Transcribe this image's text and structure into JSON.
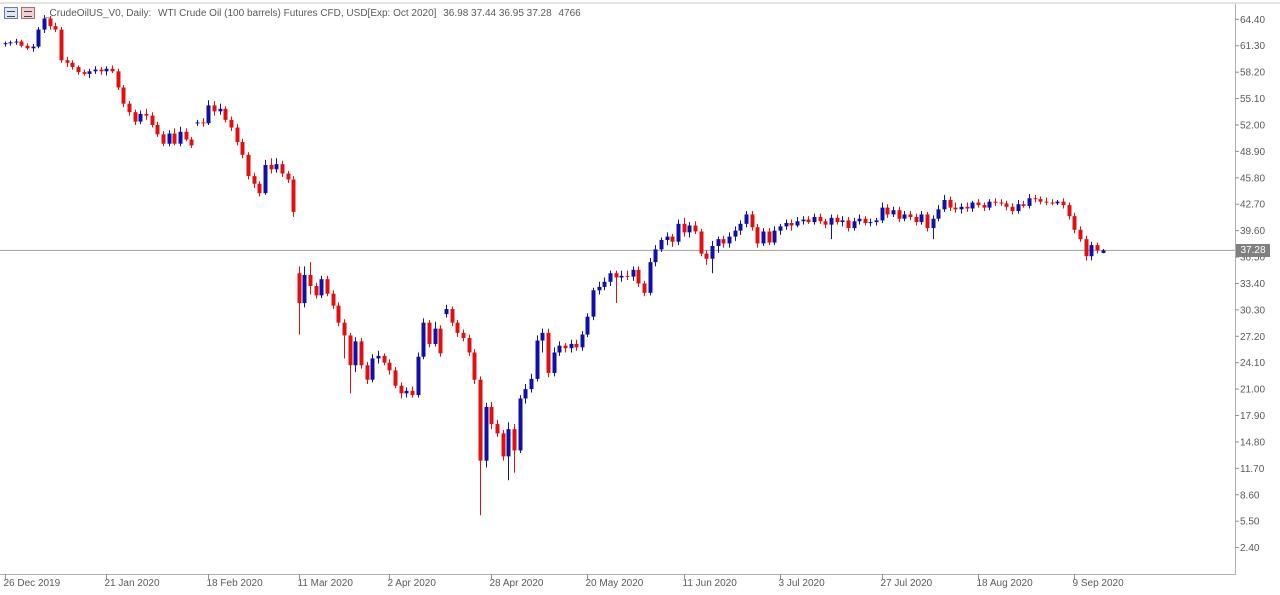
{
  "header": {
    "symbol": "_CrudeOilUS_V0, Daily:",
    "description": "WTI Crude Oil (100 barrels) Futures CFD, USD[Exp: Oct 2020]",
    "ohlc": "36.98 37.44 36.95 37.28",
    "volume": "4766"
  },
  "current_price_label": "37.28",
  "colors": {
    "bull": "#1010a8",
    "bear": "#e01010",
    "price_line": "#a0a0a0",
    "grid": "#c0c0c0",
    "text": "#5a5a5a"
  },
  "chart_data": {
    "type": "candlestick",
    "y_ticks": [
      "64.40",
      "61.30",
      "58.20",
      "55.10",
      "52.00",
      "48.90",
      "45.80",
      "42.70",
      "39.60",
      "36.50",
      "33.40",
      "30.30",
      "27.20",
      "24.10",
      "21.00",
      "17.90",
      "14.80",
      "11.70",
      "8.60",
      "5.50",
      "2.40"
    ],
    "x_ticks": [
      "26 Dec 2019",
      "21 Jan 2020",
      "18 Feb 2020",
      "11 Mar 2020",
      "2 Apr 2020",
      "28 Apr 2020",
      "20 May 2020",
      "11 Jun 2020",
      "3 Jul 2020",
      "27 Jul 2020",
      "18 Aug 2020",
      "9 Sep 2020"
    ],
    "ylim": [
      -0.7,
      66.2
    ],
    "last_price": 37.28,
    "ohlc": [
      [
        61.5,
        61.8,
        61.2,
        61.6
      ],
      [
        61.6,
        61.9,
        61.3,
        61.7
      ],
      [
        61.7,
        62.1,
        61.4,
        61.8
      ],
      [
        61.8,
        62.0,
        61.1,
        61.3
      ],
      [
        61.3,
        61.6,
        60.8,
        61.0
      ],
      [
        61.0,
        61.5,
        60.6,
        61.2
      ],
      [
        61.2,
        63.5,
        61.0,
        63.2
      ],
      [
        63.2,
        64.9,
        62.8,
        64.5
      ],
      [
        64.5,
        64.8,
        63.2,
        63.6
      ],
      [
        63.6,
        64.0,
        62.9,
        63.2
      ],
      [
        63.2,
        63.5,
        59.3,
        59.6
      ],
      [
        59.6,
        60.0,
        58.8,
        59.3
      ],
      [
        59.3,
        59.6,
        58.5,
        58.8
      ],
      [
        58.8,
        59.0,
        57.9,
        58.2
      ],
      [
        58.2,
        58.5,
        57.8,
        58.0
      ],
      [
        58.0,
        58.6,
        57.5,
        58.3
      ],
      [
        58.3,
        58.9,
        58.0,
        58.5
      ],
      [
        58.5,
        58.8,
        57.9,
        58.3
      ],
      [
        58.3,
        58.9,
        57.8,
        58.6
      ],
      [
        58.6,
        59.0,
        58.1,
        58.3
      ],
      [
        58.3,
        58.6,
        56.1,
        56.4
      ],
      [
        56.4,
        56.7,
        54.1,
        54.5
      ],
      [
        54.5,
        54.8,
        53.1,
        53.5
      ],
      [
        53.5,
        53.8,
        52.0,
        52.4
      ],
      [
        52.4,
        53.7,
        52.1,
        53.3
      ],
      [
        53.3,
        53.9,
        52.6,
        53.1
      ],
      [
        53.1,
        53.5,
        51.7,
        52.0
      ],
      [
        52.0,
        52.4,
        50.6,
        50.9
      ],
      [
        50.9,
        51.3,
        49.5,
        49.8
      ],
      [
        49.8,
        51.4,
        49.5,
        51.0
      ],
      [
        51.0,
        51.6,
        49.6,
        49.8
      ],
      [
        49.8,
        51.8,
        49.5,
        51.2
      ],
      [
        51.2,
        51.6,
        50.1,
        50.3
      ],
      [
        50.3,
        50.6,
        49.3,
        49.6
      ],
      [
        52.2,
        52.6,
        51.9,
        52.3
      ],
      [
        52.3,
        52.8,
        51.8,
        52.2
      ],
      [
        52.2,
        54.9,
        52.0,
        54.3
      ],
      [
        54.3,
        54.8,
        53.1,
        53.6
      ],
      [
        53.6,
        54.5,
        53.2,
        53.9
      ],
      [
        53.9,
        54.2,
        52.3,
        52.6
      ],
      [
        52.6,
        53.0,
        51.3,
        51.7
      ],
      [
        51.7,
        52.1,
        49.6,
        50.0
      ],
      [
        50.0,
        50.4,
        48.1,
        48.5
      ],
      [
        48.5,
        48.8,
        45.6,
        46.0
      ],
      [
        46.0,
        46.4,
        44.6,
        45.1
      ],
      [
        45.1,
        45.4,
        43.6,
        44.0
      ],
      [
        44.0,
        47.9,
        43.8,
        47.3
      ],
      [
        47.3,
        48.1,
        46.3,
        46.8
      ],
      [
        46.8,
        48.1,
        46.4,
        47.4
      ],
      [
        47.4,
        47.8,
        45.9,
        46.3
      ],
      [
        46.3,
        46.6,
        45.2,
        45.6
      ],
      [
        45.6,
        46.0,
        41.2,
        41.8
      ],
      [
        34.6,
        35.4,
        27.4,
        31.1
      ],
      [
        31.1,
        35.4,
        30.6,
        34.4
      ],
      [
        34.4,
        35.9,
        32.1,
        33.1
      ],
      [
        33.1,
        33.5,
        31.6,
        32.0
      ],
      [
        32.0,
        34.3,
        31.7,
        33.9
      ],
      [
        33.9,
        34.3,
        31.9,
        32.2
      ],
      [
        32.2,
        32.6,
        30.4,
        30.8
      ],
      [
        30.8,
        31.2,
        28.4,
        28.8
      ],
      [
        28.8,
        29.2,
        24.6,
        27.3
      ],
      [
        27.3,
        27.6,
        20.5,
        23.8
      ],
      [
        23.8,
        27.1,
        23.0,
        26.6
      ],
      [
        26.6,
        27.0,
        23.4,
        23.8
      ],
      [
        23.8,
        24.2,
        21.6,
        22.1
      ],
      [
        22.1,
        25.1,
        21.8,
        24.6
      ],
      [
        24.6,
        25.5,
        24.0,
        24.9
      ],
      [
        24.9,
        25.2,
        23.8,
        24.1
      ],
      [
        24.1,
        24.5,
        22.7,
        23.2
      ],
      [
        23.2,
        23.6,
        21.1,
        21.4
      ],
      [
        21.4,
        21.8,
        19.9,
        20.5
      ],
      [
        20.5,
        21.2,
        20.0,
        20.8
      ],
      [
        20.8,
        21.3,
        20.0,
        20.3
      ],
      [
        20.3,
        25.3,
        20.0,
        24.8
      ],
      [
        24.8,
        29.3,
        24.5,
        28.8
      ],
      [
        28.8,
        29.1,
        25.9,
        26.3
      ],
      [
        26.3,
        28.9,
        26.0,
        28.1
      ],
      [
        28.1,
        28.5,
        24.8,
        25.2
      ],
      [
        29.8,
        30.9,
        29.4,
        30.4
      ],
      [
        30.4,
        30.7,
        28.4,
        28.8
      ],
      [
        28.8,
        29.1,
        27.1,
        27.6
      ],
      [
        27.6,
        28.0,
        26.6,
        27.0
      ],
      [
        27.0,
        27.4,
        24.9,
        25.3
      ],
      [
        25.3,
        25.7,
        21.6,
        22.1
      ],
      [
        22.1,
        22.5,
        6.2,
        12.6
      ],
      [
        12.6,
        19.4,
        11.8,
        18.9
      ],
      [
        18.9,
        19.5,
        16.3,
        16.9
      ],
      [
        16.9,
        17.4,
        15.4,
        15.8
      ],
      [
        15.8,
        16.2,
        12.6,
        13.1
      ],
      [
        13.1,
        17.1,
        10.3,
        16.3
      ],
      [
        16.3,
        16.9,
        11.2,
        13.8
      ],
      [
        13.8,
        20.3,
        13.5,
        19.9
      ],
      [
        19.9,
        21.6,
        19.3,
        21.0
      ],
      [
        21.0,
        22.8,
        20.6,
        22.2
      ],
      [
        22.2,
        27.3,
        21.9,
        26.7
      ],
      [
        26.7,
        28.1,
        25.3,
        27.6
      ],
      [
        27.6,
        28.1,
        22.4,
        22.9
      ],
      [
        22.9,
        25.9,
        22.5,
        25.3
      ],
      [
        25.3,
        26.6,
        24.9,
        26.1
      ],
      [
        26.1,
        26.4,
        25.3,
        25.8
      ],
      [
        25.8,
        26.8,
        25.3,
        26.3
      ],
      [
        26.3,
        26.8,
        25.5,
        25.9
      ],
      [
        25.9,
        27.8,
        25.5,
        27.4
      ],
      [
        27.4,
        29.9,
        27.1,
        29.5
      ],
      [
        29.5,
        32.9,
        29.1,
        32.6
      ],
      [
        32.6,
        33.6,
        32.1,
        33.0
      ],
      [
        33.0,
        34.1,
        32.6,
        33.6
      ],
      [
        33.6,
        34.9,
        33.1,
        34.6
      ],
      [
        34.6,
        34.9,
        31.1,
        34.1
      ],
      [
        34.1,
        34.9,
        33.6,
        34.3
      ],
      [
        34.3,
        34.9,
        33.8,
        34.2
      ],
      [
        34.2,
        35.4,
        33.7,
        35.0
      ],
      [
        35.0,
        35.4,
        33.0,
        33.4
      ],
      [
        33.4,
        33.7,
        31.9,
        32.3
      ],
      [
        32.3,
        36.4,
        32.0,
        35.9
      ],
      [
        35.9,
        37.9,
        35.4,
        37.4
      ],
      [
        37.4,
        38.8,
        37.1,
        38.5
      ],
      [
        38.5,
        39.4,
        37.9,
        38.9
      ],
      [
        38.9,
        39.2,
        37.7,
        38.3
      ],
      [
        38.3,
        40.9,
        37.9,
        40.4
      ],
      [
        40.4,
        41.1,
        38.9,
        39.4
      ],
      [
        39.4,
        40.6,
        38.8,
        40.2
      ],
      [
        40.2,
        40.7,
        39.2,
        39.5
      ],
      [
        39.5,
        39.8,
        36.6,
        36.9
      ],
      [
        36.9,
        37.3,
        35.6,
        36.3
      ],
      [
        36.3,
        38.4,
        34.6,
        37.8
      ],
      [
        37.8,
        38.9,
        37.0,
        38.6
      ],
      [
        38.6,
        39.0,
        37.6,
        38.1
      ],
      [
        38.1,
        39.4,
        37.6,
        38.9
      ],
      [
        38.9,
        40.1,
        38.4,
        39.6
      ],
      [
        39.6,
        40.8,
        39.1,
        40.4
      ],
      [
        40.4,
        41.9,
        40.0,
        41.5
      ],
      [
        41.5,
        41.9,
        39.6,
        40.0
      ],
      [
        40.0,
        40.4,
        37.6,
        38.1
      ],
      [
        38.1,
        39.9,
        37.8,
        39.5
      ],
      [
        39.5,
        39.9,
        37.9,
        38.2
      ],
      [
        38.2,
        40.1,
        37.9,
        39.6
      ],
      [
        39.6,
        40.4,
        39.1,
        40.1
      ],
      [
        40.1,
        40.9,
        39.7,
        40.5
      ],
      [
        40.5,
        40.9,
        39.6,
        40.2
      ],
      [
        40.2,
        41.2,
        40.0,
        40.7
      ],
      [
        40.7,
        41.3,
        40.3,
        40.9
      ],
      [
        40.9,
        41.3,
        40.4,
        40.6
      ],
      [
        40.6,
        41.6,
        40.3,
        41.2
      ],
      [
        41.2,
        41.6,
        40.4,
        40.7
      ],
      [
        40.7,
        41.0,
        39.9,
        40.3
      ],
      [
        40.3,
        41.5,
        38.6,
        41.1
      ],
      [
        41.1,
        41.5,
        40.3,
        40.6
      ],
      [
        40.6,
        41.3,
        40.1,
        40.8
      ],
      [
        40.8,
        41.2,
        39.5,
        39.9
      ],
      [
        39.9,
        41.1,
        39.6,
        40.7
      ],
      [
        40.7,
        41.5,
        40.3,
        41.0
      ],
      [
        41.0,
        41.3,
        40.2,
        40.5
      ],
      [
        40.5,
        41.0,
        40.1,
        40.6
      ],
      [
        40.6,
        41.1,
        40.2,
        40.8
      ],
      [
        40.8,
        42.9,
        40.5,
        42.3
      ],
      [
        42.3,
        42.7,
        41.1,
        41.5
      ],
      [
        41.5,
        42.4,
        41.2,
        42.0
      ],
      [
        42.0,
        42.4,
        40.6,
        41.0
      ],
      [
        41.0,
        41.9,
        40.7,
        41.5
      ],
      [
        41.5,
        41.9,
        40.8,
        41.2
      ],
      [
        41.2,
        41.6,
        40.2,
        40.6
      ],
      [
        40.6,
        41.9,
        40.3,
        41.5
      ],
      [
        41.5,
        41.8,
        39.5,
        39.9
      ],
      [
        39.9,
        41.4,
        38.6,
        41.0
      ],
      [
        41.0,
        42.6,
        40.7,
        42.1
      ],
      [
        42.1,
        43.8,
        41.8,
        43.2
      ],
      [
        43.2,
        43.6,
        41.9,
        42.3
      ],
      [
        42.3,
        42.9,
        41.7,
        42.1
      ],
      [
        42.1,
        42.8,
        41.6,
        42.4
      ],
      [
        42.4,
        42.9,
        41.8,
        42.2
      ],
      [
        42.2,
        43.1,
        41.8,
        42.9
      ],
      [
        42.9,
        43.3,
        42.3,
        42.6
      ],
      [
        42.6,
        42.9,
        41.9,
        42.3
      ],
      [
        42.3,
        43.3,
        42.0,
        43.0
      ],
      [
        43.0,
        43.4,
        42.5,
        42.9
      ],
      [
        42.9,
        43.3,
        42.5,
        42.8
      ],
      [
        42.8,
        43.1,
        42.0,
        42.4
      ],
      [
        42.4,
        42.8,
        41.5,
        41.9
      ],
      [
        41.9,
        43.2,
        41.6,
        42.7
      ],
      [
        42.7,
        43.1,
        42.3,
        42.5
      ],
      [
        42.5,
        43.9,
        42.2,
        43.4
      ],
      [
        43.4,
        43.8,
        42.9,
        43.3
      ],
      [
        43.3,
        43.6,
        42.7,
        43.0
      ],
      [
        43.0,
        43.5,
        42.6,
        42.9
      ],
      [
        42.9,
        43.3,
        42.6,
        42.8
      ],
      [
        42.8,
        43.2,
        42.6,
        43.0
      ],
      [
        43.0,
        43.4,
        42.2,
        42.6
      ],
      [
        42.6,
        42.9,
        40.9,
        41.3
      ],
      [
        41.3,
        41.7,
        39.3,
        39.7
      ],
      [
        39.7,
        40.1,
        38.3,
        38.6
      ],
      [
        38.6,
        39.0,
        36.1,
        36.6
      ],
      [
        36.6,
        38.3,
        36.1,
        37.9
      ],
      [
        37.9,
        38.2,
        36.9,
        37.3
      ],
      [
        36.98,
        37.44,
        36.95,
        37.28
      ]
    ]
  }
}
